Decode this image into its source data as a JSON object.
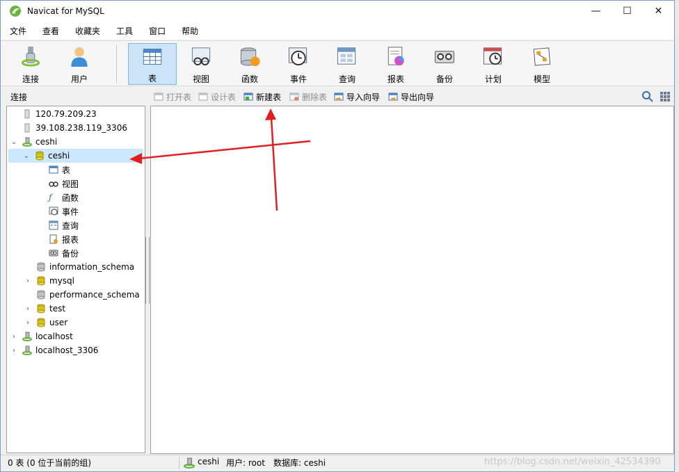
{
  "window": {
    "title": "Navicat for MySQL",
    "controls": {
      "minimize": "—",
      "maximize": "☐",
      "close": "✕"
    }
  },
  "menu": [
    "文件",
    "查看",
    "收藏夹",
    "工具",
    "窗口",
    "帮助"
  ],
  "toolbar": [
    {
      "label": "连接",
      "icon": "plug-icon"
    },
    {
      "label": "用户",
      "icon": "user-icon"
    },
    {
      "label": "表",
      "icon": "table-icon",
      "active": true
    },
    {
      "label": "视图",
      "icon": "view-icon"
    },
    {
      "label": "函数",
      "icon": "function-icon"
    },
    {
      "label": "事件",
      "icon": "event-clock-icon"
    },
    {
      "label": "查询",
      "icon": "query-icon"
    },
    {
      "label": "报表",
      "icon": "report-icon"
    },
    {
      "label": "备份",
      "icon": "backup-tape-icon"
    },
    {
      "label": "计划",
      "icon": "schedule-icon"
    },
    {
      "label": "模型",
      "icon": "model-icon"
    }
  ],
  "subtoolbar": {
    "connection_label": "连接",
    "actions": [
      {
        "label": "打开表",
        "enabled": false
      },
      {
        "label": "设计表",
        "enabled": false
      },
      {
        "label": "新建表",
        "enabled": true
      },
      {
        "label": "删除表",
        "enabled": false
      },
      {
        "label": "导入向导",
        "enabled": true
      },
      {
        "label": "导出向导",
        "enabled": true
      }
    ]
  },
  "tree": [
    {
      "label": "120.79.209.23",
      "level": 0,
      "type": "connection-closed"
    },
    {
      "label": "39.108.238.119_3306",
      "level": 0,
      "type": "connection-closed"
    },
    {
      "label": "ceshi",
      "level": 0,
      "type": "connection-open",
      "expanded": true
    },
    {
      "label": "ceshi",
      "level": 1,
      "type": "database-open",
      "expanded": true,
      "selected": true
    },
    {
      "label": "表",
      "level": 2,
      "type": "tables"
    },
    {
      "label": "视图",
      "level": 2,
      "type": "views"
    },
    {
      "label": "函数",
      "level": 2,
      "type": "functions"
    },
    {
      "label": "事件",
      "level": 2,
      "type": "events"
    },
    {
      "label": "查询",
      "level": 2,
      "type": "queries"
    },
    {
      "label": "报表",
      "level": 2,
      "type": "reports"
    },
    {
      "label": "备份",
      "level": 2,
      "type": "backups"
    },
    {
      "label": "information_schema",
      "level": 1,
      "type": "database-closed"
    },
    {
      "label": "mysql",
      "level": 1,
      "type": "database",
      "collapsed": true
    },
    {
      "label": "performance_schema",
      "level": 1,
      "type": "database-closed"
    },
    {
      "label": "test",
      "level": 1,
      "type": "database",
      "collapsed": true
    },
    {
      "label": "user",
      "level": 1,
      "type": "database",
      "collapsed": true
    },
    {
      "label": "localhost",
      "level": 0,
      "type": "connection-open",
      "collapsed": true
    },
    {
      "label": "localhost_3306",
      "level": 0,
      "type": "connection-open",
      "collapsed": true
    }
  ],
  "status": {
    "left": "0 表 (0 位于当前的组)",
    "connection": "ceshi",
    "user": "用户: root",
    "database": "数据库: ceshi",
    "watermark": "https://blog.csdn.net/weixin_42534390"
  },
  "colors": {
    "arrow": "#e02020",
    "selection": "#cce8ff",
    "active_tool": "#cce4f7",
    "db_yellow": "#d4c21a"
  }
}
